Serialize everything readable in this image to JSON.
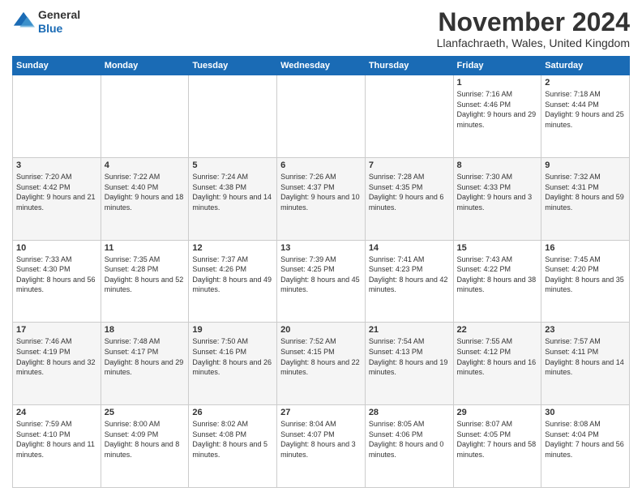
{
  "header": {
    "logo": {
      "general": "General",
      "blue": "Blue"
    },
    "title": "November 2024",
    "location": "Llanfachraeth, Wales, United Kingdom"
  },
  "days_of_week": [
    "Sunday",
    "Monday",
    "Tuesday",
    "Wednesday",
    "Thursday",
    "Friday",
    "Saturday"
  ],
  "weeks": [
    [
      {
        "day": "",
        "info": ""
      },
      {
        "day": "",
        "info": ""
      },
      {
        "day": "",
        "info": ""
      },
      {
        "day": "",
        "info": ""
      },
      {
        "day": "",
        "info": ""
      },
      {
        "day": "1",
        "info": "Sunrise: 7:16 AM\nSunset: 4:46 PM\nDaylight: 9 hours and 29 minutes."
      },
      {
        "day": "2",
        "info": "Sunrise: 7:18 AM\nSunset: 4:44 PM\nDaylight: 9 hours and 25 minutes."
      }
    ],
    [
      {
        "day": "3",
        "info": "Sunrise: 7:20 AM\nSunset: 4:42 PM\nDaylight: 9 hours and 21 minutes."
      },
      {
        "day": "4",
        "info": "Sunrise: 7:22 AM\nSunset: 4:40 PM\nDaylight: 9 hours and 18 minutes."
      },
      {
        "day": "5",
        "info": "Sunrise: 7:24 AM\nSunset: 4:38 PM\nDaylight: 9 hours and 14 minutes."
      },
      {
        "day": "6",
        "info": "Sunrise: 7:26 AM\nSunset: 4:37 PM\nDaylight: 9 hours and 10 minutes."
      },
      {
        "day": "7",
        "info": "Sunrise: 7:28 AM\nSunset: 4:35 PM\nDaylight: 9 hours and 6 minutes."
      },
      {
        "day": "8",
        "info": "Sunrise: 7:30 AM\nSunset: 4:33 PM\nDaylight: 9 hours and 3 minutes."
      },
      {
        "day": "9",
        "info": "Sunrise: 7:32 AM\nSunset: 4:31 PM\nDaylight: 8 hours and 59 minutes."
      }
    ],
    [
      {
        "day": "10",
        "info": "Sunrise: 7:33 AM\nSunset: 4:30 PM\nDaylight: 8 hours and 56 minutes."
      },
      {
        "day": "11",
        "info": "Sunrise: 7:35 AM\nSunset: 4:28 PM\nDaylight: 8 hours and 52 minutes."
      },
      {
        "day": "12",
        "info": "Sunrise: 7:37 AM\nSunset: 4:26 PM\nDaylight: 8 hours and 49 minutes."
      },
      {
        "day": "13",
        "info": "Sunrise: 7:39 AM\nSunset: 4:25 PM\nDaylight: 8 hours and 45 minutes."
      },
      {
        "day": "14",
        "info": "Sunrise: 7:41 AM\nSunset: 4:23 PM\nDaylight: 8 hours and 42 minutes."
      },
      {
        "day": "15",
        "info": "Sunrise: 7:43 AM\nSunset: 4:22 PM\nDaylight: 8 hours and 38 minutes."
      },
      {
        "day": "16",
        "info": "Sunrise: 7:45 AM\nSunset: 4:20 PM\nDaylight: 8 hours and 35 minutes."
      }
    ],
    [
      {
        "day": "17",
        "info": "Sunrise: 7:46 AM\nSunset: 4:19 PM\nDaylight: 8 hours and 32 minutes."
      },
      {
        "day": "18",
        "info": "Sunrise: 7:48 AM\nSunset: 4:17 PM\nDaylight: 8 hours and 29 minutes."
      },
      {
        "day": "19",
        "info": "Sunrise: 7:50 AM\nSunset: 4:16 PM\nDaylight: 8 hours and 26 minutes."
      },
      {
        "day": "20",
        "info": "Sunrise: 7:52 AM\nSunset: 4:15 PM\nDaylight: 8 hours and 22 minutes."
      },
      {
        "day": "21",
        "info": "Sunrise: 7:54 AM\nSunset: 4:13 PM\nDaylight: 8 hours and 19 minutes."
      },
      {
        "day": "22",
        "info": "Sunrise: 7:55 AM\nSunset: 4:12 PM\nDaylight: 8 hours and 16 minutes."
      },
      {
        "day": "23",
        "info": "Sunrise: 7:57 AM\nSunset: 4:11 PM\nDaylight: 8 hours and 14 minutes."
      }
    ],
    [
      {
        "day": "24",
        "info": "Sunrise: 7:59 AM\nSunset: 4:10 PM\nDaylight: 8 hours and 11 minutes."
      },
      {
        "day": "25",
        "info": "Sunrise: 8:00 AM\nSunset: 4:09 PM\nDaylight: 8 hours and 8 minutes."
      },
      {
        "day": "26",
        "info": "Sunrise: 8:02 AM\nSunset: 4:08 PM\nDaylight: 8 hours and 5 minutes."
      },
      {
        "day": "27",
        "info": "Sunrise: 8:04 AM\nSunset: 4:07 PM\nDaylight: 8 hours and 3 minutes."
      },
      {
        "day": "28",
        "info": "Sunrise: 8:05 AM\nSunset: 4:06 PM\nDaylight: 8 hours and 0 minutes."
      },
      {
        "day": "29",
        "info": "Sunrise: 8:07 AM\nSunset: 4:05 PM\nDaylight: 7 hours and 58 minutes."
      },
      {
        "day": "30",
        "info": "Sunrise: 8:08 AM\nSunset: 4:04 PM\nDaylight: 7 hours and 56 minutes."
      }
    ]
  ]
}
